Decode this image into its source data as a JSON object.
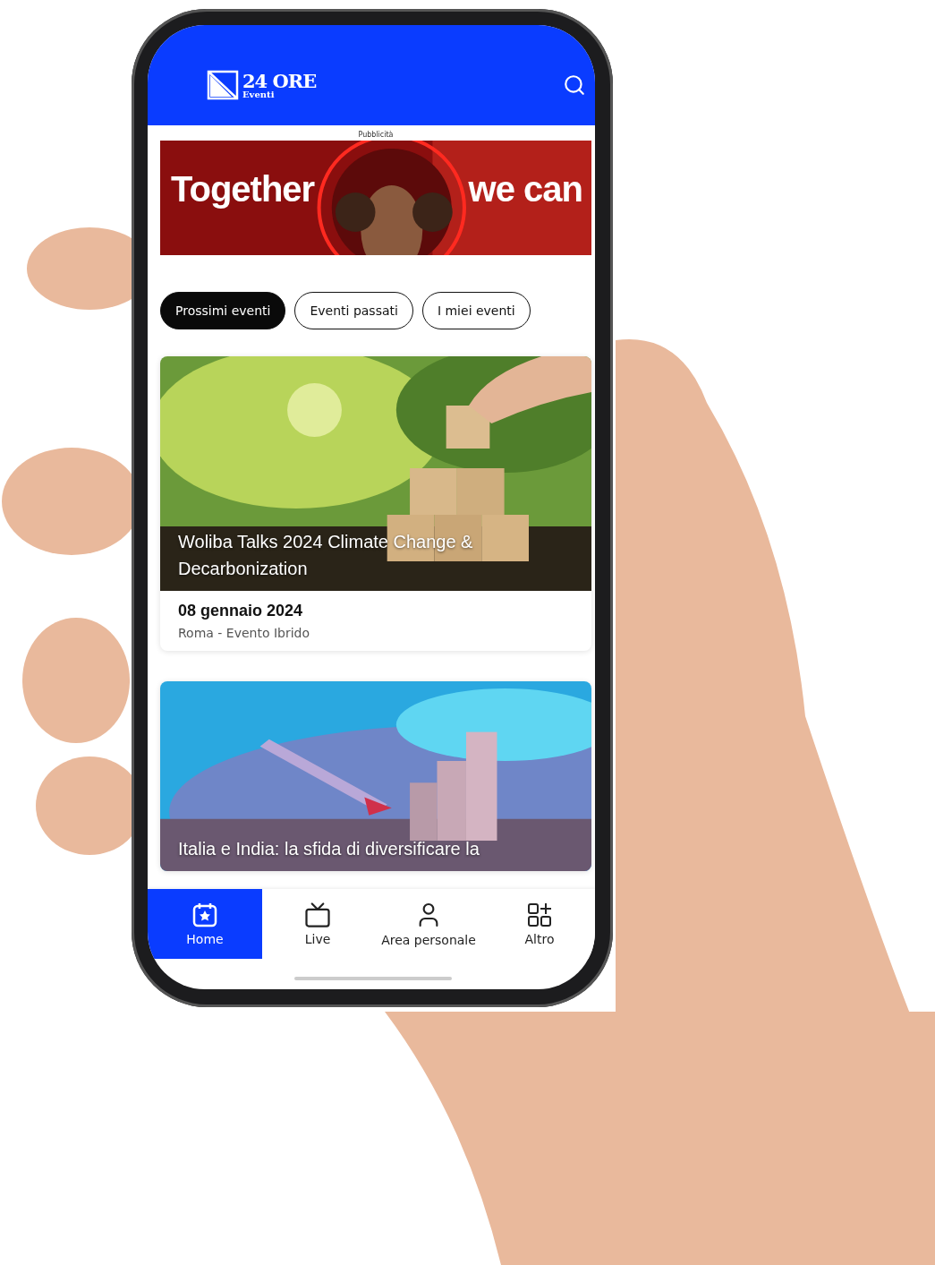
{
  "header": {
    "logo_title": "24 ORE",
    "logo_subtitle": "Eventi"
  },
  "ad": {
    "label": "Pubblicità",
    "headline_left": "Together",
    "headline_right": "we can"
  },
  "tabs": [
    {
      "label": "Prossimi eventi",
      "selected": true
    },
    {
      "label": "Eventi passati",
      "selected": false
    },
    {
      "label": "I miei eventi",
      "selected": false
    }
  ],
  "events": [
    {
      "title": "Woliba Talks 2024 Climate Change & Decarbonization",
      "date": "08 gennaio 2024",
      "place": "Roma - Evento Ibrido"
    },
    {
      "title": "Italia e India: la sfida di diversificare la"
    }
  ],
  "nav": [
    {
      "label": "Home",
      "selected": true
    },
    {
      "label": "Live",
      "selected": false
    },
    {
      "label": "Area personale",
      "selected": false
    },
    {
      "label": "Altro",
      "selected": false
    }
  ]
}
